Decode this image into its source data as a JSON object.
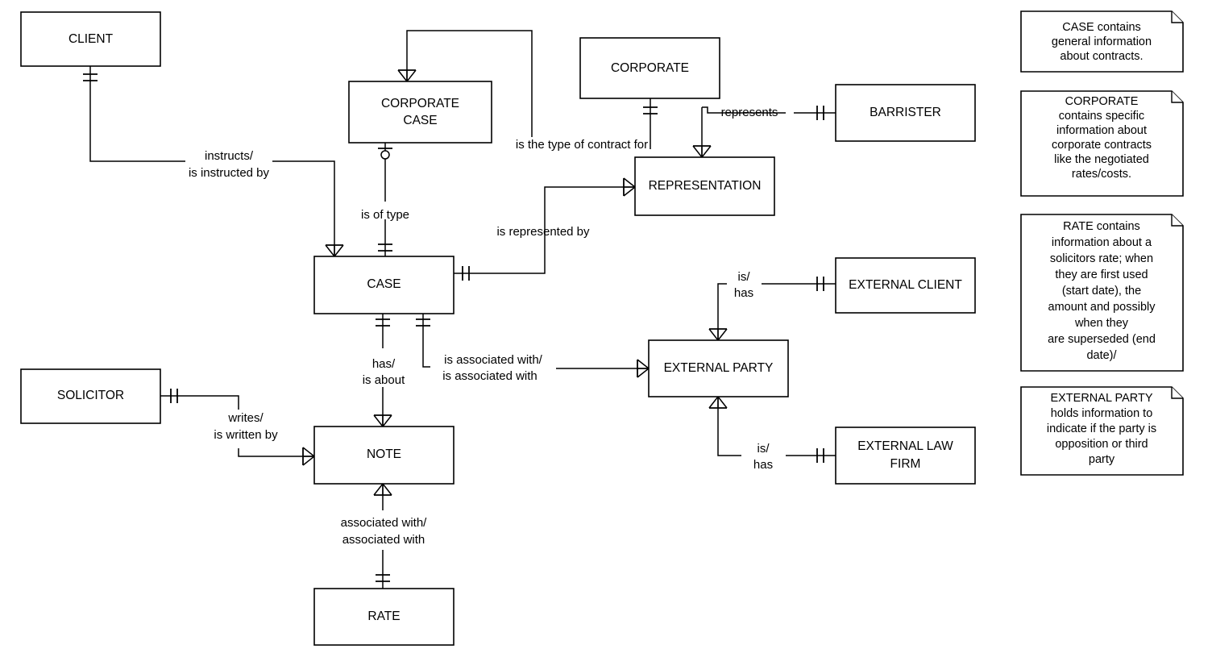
{
  "diagram": {
    "title": "Legal Case Management ER Diagram",
    "background_color": "#ffffff",
    "line_color": "#000000",
    "entities": [
      {
        "id": "client",
        "label": "CLIENT"
      },
      {
        "id": "corporate_case",
        "label_line1": "CORPORATE",
        "label_line2": "CASE"
      },
      {
        "id": "corporate",
        "label": "CORPORATE"
      },
      {
        "id": "barrister",
        "label": "BARRISTER"
      },
      {
        "id": "representation",
        "label": "REPRESENTATION"
      },
      {
        "id": "case",
        "label": "CASE"
      },
      {
        "id": "external_client",
        "label": "EXTERNAL CLIENT"
      },
      {
        "id": "external_party",
        "label": "EXTERNAL PARTY"
      },
      {
        "id": "external_law_firm",
        "label_line1": "EXTERNAL LAW",
        "label_line2": "FIRM"
      },
      {
        "id": "solicitor",
        "label": "SOLICITOR"
      },
      {
        "id": "note",
        "label": "NOTE"
      },
      {
        "id": "rate",
        "label": "RATE"
      }
    ],
    "relationships": [
      {
        "id": "client_case",
        "line1": "instructs/",
        "line2": "is instructed by"
      },
      {
        "id": "corporatecase_case",
        "line1": "is of type",
        "line2": ""
      },
      {
        "id": "corporatecase_contract",
        "line1": "is the type of contract for",
        "line2": ""
      },
      {
        "id": "barrister_rep",
        "line1": "represents",
        "line2": ""
      },
      {
        "id": "case_rep",
        "line1": "is represented by",
        "line2": ""
      },
      {
        "id": "case_note",
        "line1": "has/",
        "line2": "is about"
      },
      {
        "id": "case_extparty",
        "line1": "is associated with/",
        "line2": "is associated with"
      },
      {
        "id": "extparty_extclient",
        "line1": "is/",
        "line2": "has"
      },
      {
        "id": "extparty_extlawfirm",
        "line1": "is/",
        "line2": "has"
      },
      {
        "id": "solicitor_note",
        "line1": "writes/",
        "line2": "is written by"
      },
      {
        "id": "note_rate",
        "line1": "associated with/",
        "line2": "associated with"
      }
    ],
    "notes": [
      {
        "id": "note_case",
        "lines": [
          "CASE contains",
          "general information",
          "about contracts."
        ]
      },
      {
        "id": "note_corporate",
        "lines": [
          "CORPORATE",
          "contains specific",
          "information about",
          "corporate contracts",
          "like the negotiated",
          "rates/costs."
        ]
      },
      {
        "id": "note_rate",
        "lines": [
          "RATE contains",
          "information about a",
          "solicitors rate; when",
          "they are first used",
          "(start date), the",
          "amount and possibly",
          "when they",
          "are superseded (end",
          "date)/"
        ]
      },
      {
        "id": "note_external_party",
        "lines": [
          "EXTERNAL PARTY",
          "holds information to",
          "indicate if the party is",
          "opposition or third",
          "party"
        ]
      }
    ]
  }
}
